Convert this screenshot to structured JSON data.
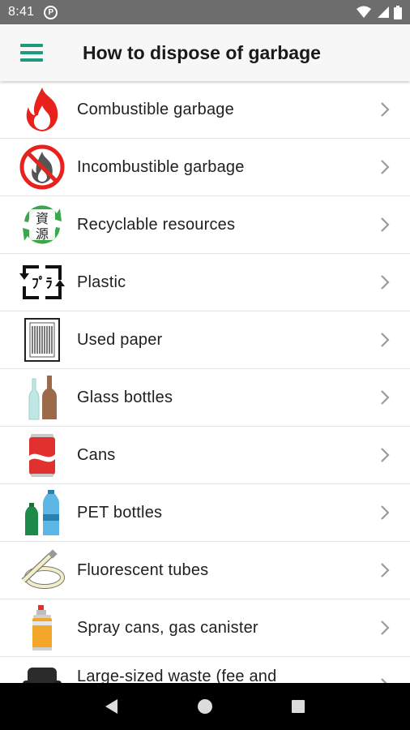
{
  "status_bar": {
    "time": "8:41"
  },
  "app_bar": {
    "title": "How to dispose of garbage"
  },
  "items": [
    {
      "label": "Combustible garbage",
      "icon": "fire-icon"
    },
    {
      "label": "Incombustible garbage",
      "icon": "no-fire-icon"
    },
    {
      "label": "Recyclable resources",
      "icon": "recycle-resources-icon"
    },
    {
      "label": "Plastic",
      "icon": "plastic-mark-icon"
    },
    {
      "label": "Used paper",
      "icon": "paper-icon"
    },
    {
      "label": "Glass bottles",
      "icon": "glass-bottles-icon"
    },
    {
      "label": "Cans",
      "icon": "can-icon"
    },
    {
      "label": "PET bottles",
      "icon": "pet-bottles-icon"
    },
    {
      "label": "Fluorescent tubes",
      "icon": "fluorescent-tube-icon"
    },
    {
      "label": "Spray cans, gas canister",
      "icon": "spray-can-icon"
    },
    {
      "label": "Large-sized waste (fee and",
      "icon": "large-waste-icon"
    }
  ],
  "recycle_chars": {
    "top": "資",
    "bottom": "源"
  },
  "plastic_mark_text": "ﾌﾟﾗ",
  "colors": {
    "accent": "#1f9a7e",
    "status_bar": "#6d6d6d",
    "fire": "#e8211c",
    "recycle": "#3aa84a"
  }
}
